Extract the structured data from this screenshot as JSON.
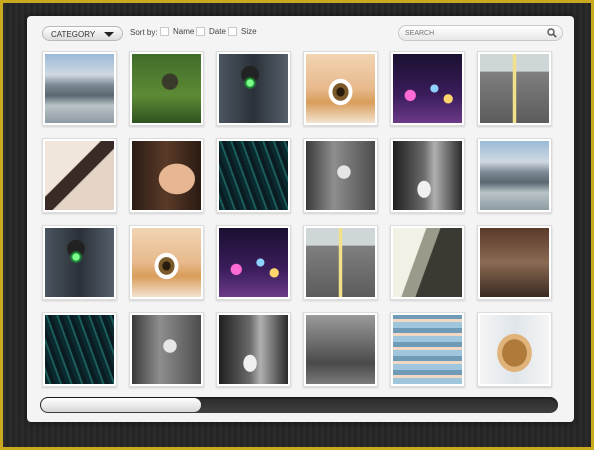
{
  "toolbar": {
    "category_label": "CATEGORY",
    "sort_by_label": "Sort by:",
    "sort_options": [
      "Name",
      "Date",
      "Size"
    ],
    "search_placeholder": "SEARCH"
  },
  "gallery": {
    "thumbnails": [
      {
        "subject": "bridge",
        "row": 1,
        "col": 1
      },
      {
        "subject": "photographer-grass",
        "row": 1,
        "col": 2
      },
      {
        "subject": "green-traffic-light",
        "row": 1,
        "col": 3
      },
      {
        "subject": "eye-closeup",
        "row": 1,
        "col": 4
      },
      {
        "subject": "city-lights-bokeh",
        "row": 1,
        "col": 5
      },
      {
        "subject": "empty-road",
        "row": 1,
        "col": 6
      },
      {
        "subject": "feathers-face",
        "row": 2,
        "col": 1
      },
      {
        "subject": "woman-profile",
        "row": 2,
        "col": 2
      },
      {
        "subject": "dark-grass",
        "row": 2,
        "col": 3
      },
      {
        "subject": "girl-street-bw",
        "row": 2,
        "col": 4
      },
      {
        "subject": "wedding-couple-bw",
        "row": 2,
        "col": 5
      },
      {
        "subject": "bridge",
        "row": 2,
        "col": 6
      },
      {
        "subject": "green-traffic-light",
        "row": 3,
        "col": 1
      },
      {
        "subject": "eye-closeup",
        "row": 3,
        "col": 2
      },
      {
        "subject": "city-lights-bokeh",
        "row": 3,
        "col": 3
      },
      {
        "subject": "empty-road",
        "row": 3,
        "col": 4
      },
      {
        "subject": "hair-portrait-bw",
        "row": 3,
        "col": 5
      },
      {
        "subject": "broken-wood",
        "row": 3,
        "col": 6
      },
      {
        "subject": "dark-grass",
        "row": 4,
        "col": 1
      },
      {
        "subject": "girl-street-bw",
        "row": 4,
        "col": 2
      },
      {
        "subject": "wedding-couple-bw",
        "row": 4,
        "col": 3
      },
      {
        "subject": "old-building",
        "row": 4,
        "col": 4
      },
      {
        "subject": "torn-jeans",
        "row": 4,
        "col": 5
      },
      {
        "subject": "angel-wings-hair",
        "row": 4,
        "col": 6
      }
    ]
  },
  "scroll": {
    "position_fraction": 0.31
  },
  "colors": {
    "frame": "#c9a91d",
    "panel": "#f4f4f4",
    "scrollbar_track": "#333333"
  }
}
